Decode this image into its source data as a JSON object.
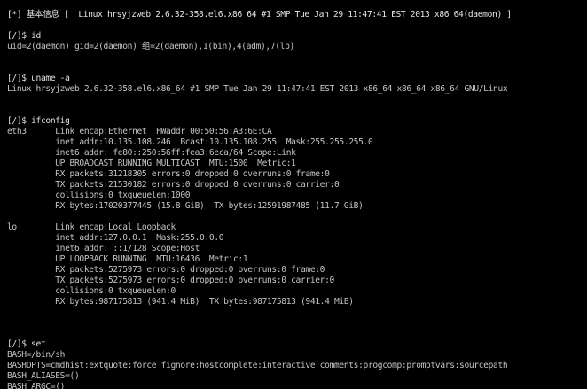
{
  "terminal": {
    "lines": [
      "[*] 基本信息 [  Linux hrsyjzweb 2.6.32-358.el6.x86_64 #1 SMP Tue Jan 29 11:47:41 EST 2013 x86_64(daemon) ]",
      "[/]$ id",
      "uid=2(daemon) gid=2(daemon) 组=2(daemon),1(bin),4(adm),7(lp)",
      "[/]$ uname -a",
      "Linux hrsyjzweb 2.6.32-358.el6.x86_64 #1 SMP Tue Jan 29 11:47:41 EST 2013 x86_64 x86_64 x86_64 GNU/Linux",
      "[/]$ ifconfig",
      "eth3      Link encap:Ethernet  HWaddr 00:50:56:A3:6E:CA",
      "          inet addr:10.135.108.246  Bcast:10.135.108.255  Mask:255.255.255.0",
      "          inet6 addr: fe80::250:56ff:fea3:6eca/64 Scope:Link",
      "          UP BROADCAST RUNNING MULTICAST  MTU:1500  Metric:1",
      "          RX packets:31218305 errors:0 dropped:0 overruns:0 frame:0",
      "          TX packets:21530182 errors:0 dropped:0 overruns:0 carrier:0",
      "          collisions:0 txqueuelen:1000",
      "          RX bytes:17020377445 (15.8 GiB)  TX bytes:12591987485 (11.7 GiB)",
      "lo        Link encap:Local Loopback",
      "          inet addr:127.0.0.1  Mask:255.0.0.0",
      "          inet6 addr: ::1/128 Scope:Host",
      "          UP LOOPBACK RUNNING  MTU:16436  Metric:1",
      "          RX packets:5275973 errors:0 dropped:0 overruns:0 frame:0",
      "          TX packets:5275973 errors:0 dropped:0 overruns:0 carrier:0",
      "          collisions:0 txqueuelen:0",
      "          RX bytes:987175813 (941.4 MiB)  TX bytes:987175813 (941.4 MiB)",
      "[/]$ set",
      "BASH=/bin/sh",
      "BASHOPTS=cmdhist:extquote:force_fignore:hostcomplete:interactive_comments:progcomp:promptvars:sourcepath",
      "BASH_ALIASES=()",
      "BASH_ARGC=()"
    ]
  }
}
